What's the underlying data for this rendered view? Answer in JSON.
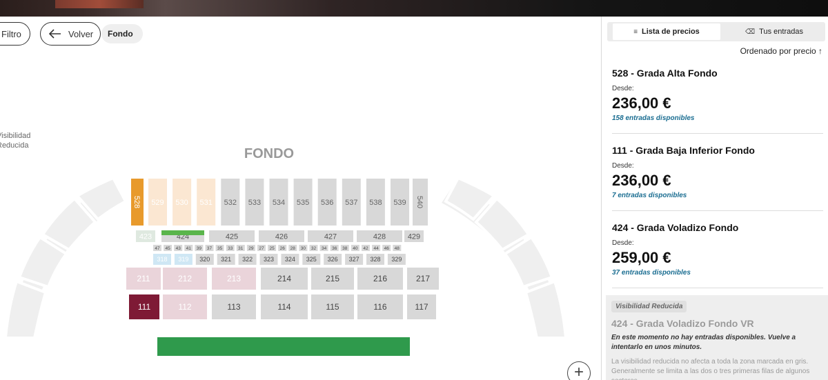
{
  "toolbar": {
    "filter_label": "Filtro",
    "back_label": "Volver",
    "section_label": "Fondo"
  },
  "map": {
    "title": "FONDO",
    "visibility_label_1": "Visibilidad",
    "visibility_label_2": "Reducida",
    "zoom_in": "+",
    "top_row": [
      "528",
      "529",
      "530",
      "531",
      "532",
      "533",
      "534",
      "535",
      "536",
      "537",
      "538",
      "539",
      "540"
    ],
    "upper_mid": [
      "423",
      "424",
      "425",
      "426",
      "427",
      "428",
      "429"
    ],
    "small_row": [
      "47",
      "45",
      "43",
      "41",
      "39",
      "37",
      "35",
      "33",
      "31",
      "29",
      "27",
      "25",
      "26",
      "28",
      "30",
      "32",
      "34",
      "36",
      "38",
      "40",
      "42",
      "44",
      "46",
      "48"
    ],
    "row_300": [
      "318",
      "319",
      "320",
      "321",
      "322",
      "323",
      "324",
      "325",
      "326",
      "327",
      "328",
      "329"
    ],
    "row_200": [
      "211",
      "212",
      "213",
      "214",
      "215",
      "216",
      "217"
    ],
    "row_100": [
      "111",
      "112",
      "113",
      "114",
      "115",
      "116",
      "117"
    ]
  },
  "panel": {
    "tab_prices": "Lista de precios",
    "tab_tickets": "Tus entradas",
    "sort_label": "Ordenado por precio ↑",
    "listings": [
      {
        "name": "528 - Grada Alta Fondo",
        "from_label": "Desde:",
        "price": "236,00 €",
        "available": "158 entradas disponibles"
      },
      {
        "name": "111 - Grada Baja Inferior Fondo",
        "from_label": "Desde:",
        "price": "236,00 €",
        "available": "7 entradas disponibles"
      },
      {
        "name": "424 - Grada Voladizo Fondo",
        "from_label": "Desde:",
        "price": "259,00 €",
        "available": "37 entradas disponibles"
      }
    ],
    "reduced": {
      "badge": "Visibilidad Reducida",
      "name": "424 - Grada Voladizo Fondo VR",
      "message": "En este momento no hay entradas disponibles. Vuelve a intentarlo en unos minutos.",
      "info": "La visibilidad reducida no afecta a toda la zona marcada en gris. Generalmente se limita a las dos o tres primeras filas de algunos sectores."
    }
  },
  "colors": {
    "cheapest": "#e89a2c",
    "cheap_light": "#fbe7d2",
    "selected": "#5ab54b",
    "reduced": "#cfe7f4",
    "mid": "#ead4da",
    "dark": "#7e1a35",
    "field": "#2f9a4c",
    "grey_section": "#d8d8d8",
    "grey_outer": "#efefef"
  }
}
